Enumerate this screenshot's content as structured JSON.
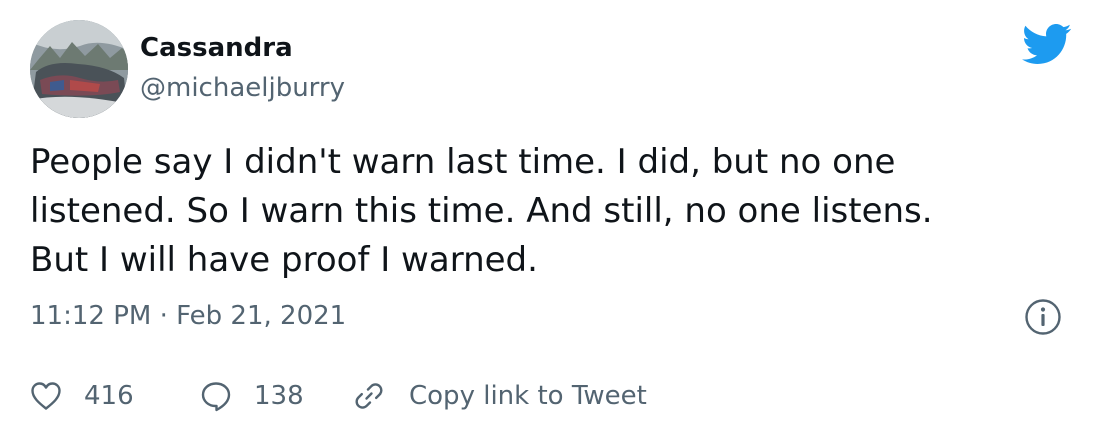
{
  "author": {
    "display_name": "Cassandra",
    "handle": "@michaeljburry",
    "avatar_icon": "avatar-photo"
  },
  "brand": {
    "logo_icon": "twitter-bird-icon",
    "color": "#1d9bf0"
  },
  "tweet": {
    "text": "People say I didn't warn last time. I did, but no one\nlistened. So I warn this time. And still, no one listens.\nBut I will have proof I warned."
  },
  "meta": {
    "time": "11:12 PM",
    "separator": "·",
    "date": "Feb 21, 2021",
    "info_icon": "info-icon"
  },
  "actions": {
    "like_count": "416",
    "reply_count": "138",
    "copy_link_label": "Copy link to Tweet"
  },
  "colors": {
    "text_primary": "#0f1419",
    "text_secondary": "#536471"
  }
}
